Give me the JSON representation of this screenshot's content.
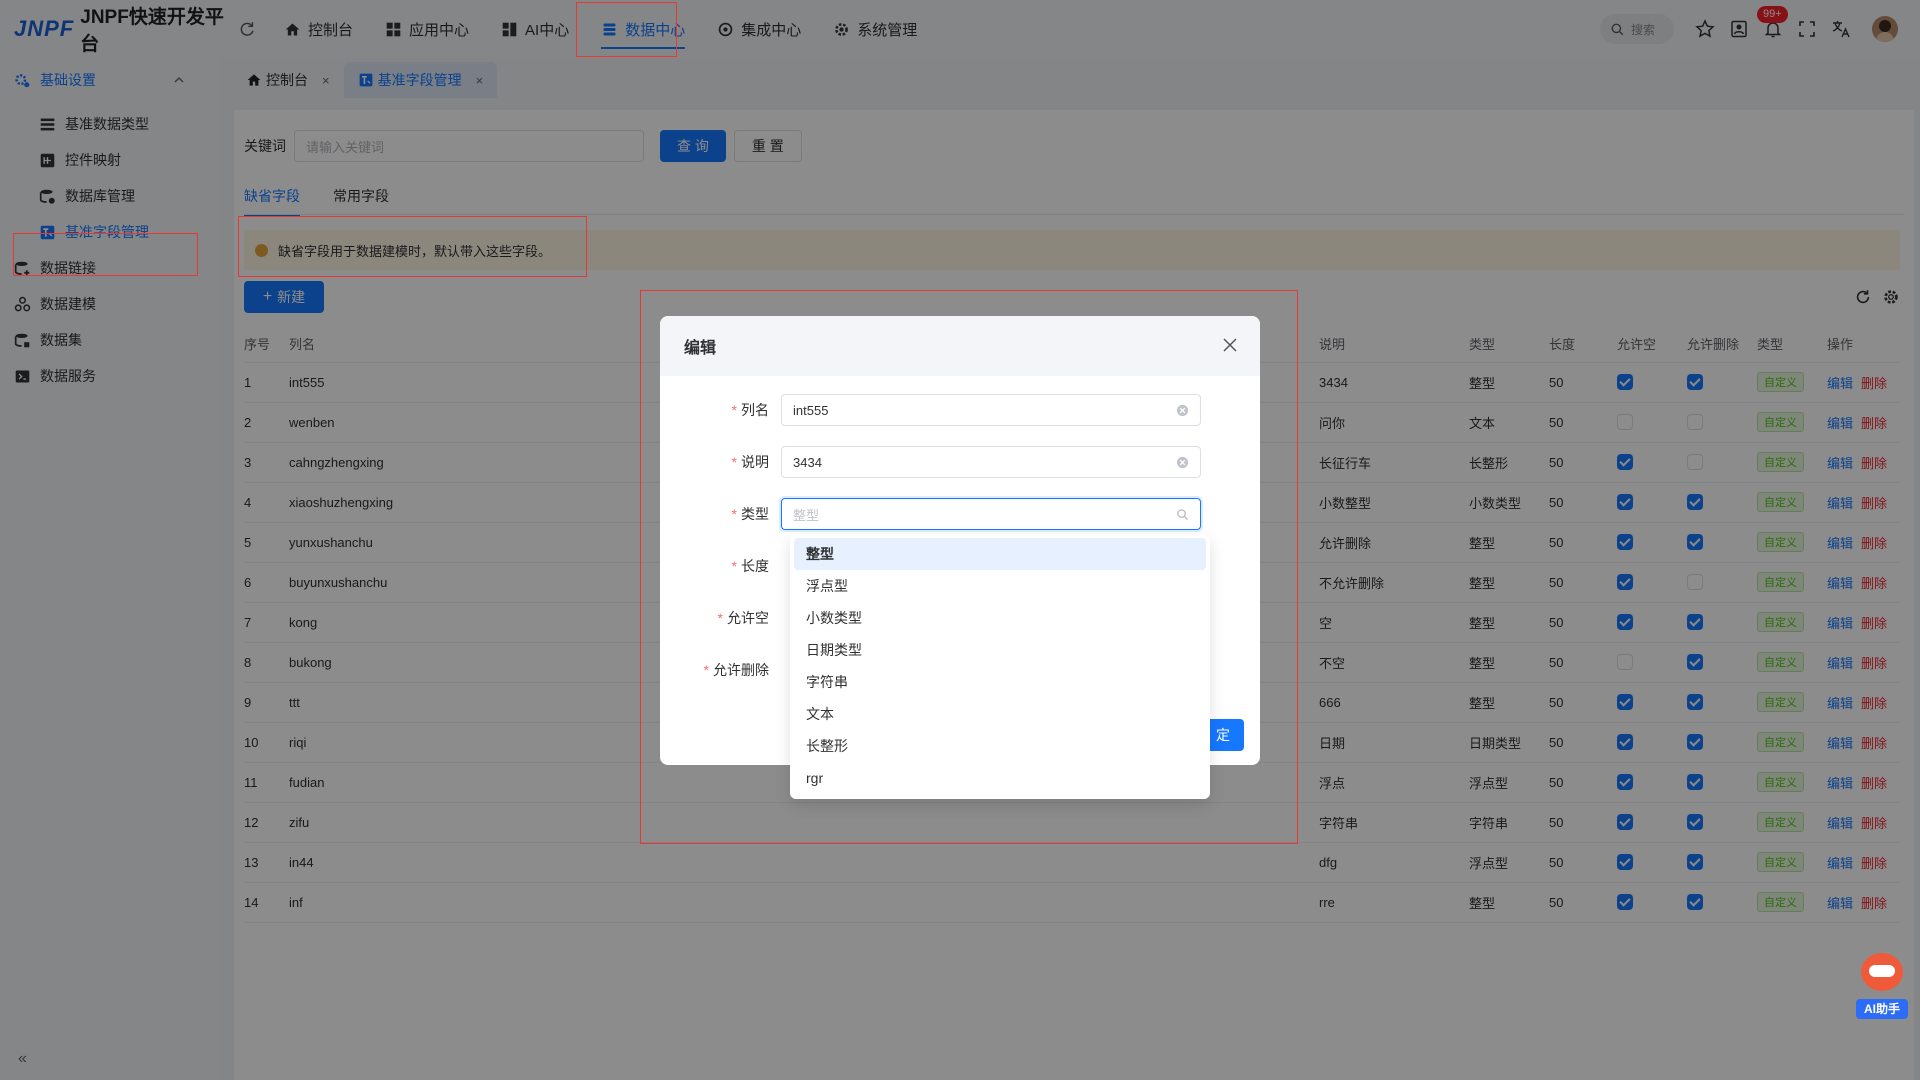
{
  "app": {
    "logo_mark": "JNPF",
    "title": "JNPF快速开发平台"
  },
  "topnav": [
    {
      "label": "控制台",
      "icon": "home-icon"
    },
    {
      "label": "应用中心",
      "icon": "apps-icon"
    },
    {
      "label": "AI中心",
      "icon": "ai-icon"
    },
    {
      "label": "数据中心",
      "icon": "database-icon"
    },
    {
      "label": "集成中心",
      "icon": "integration-icon"
    },
    {
      "label": "系统管理",
      "icon": "gear-icon"
    }
  ],
  "header_right": {
    "search_placeholder": "搜索",
    "notification_badge": "99+"
  },
  "sidebar": {
    "items": [
      {
        "label": "基础设置",
        "icon": "settings-group-icon"
      },
      {
        "label": "基准数据类型",
        "icon": "list-icon"
      },
      {
        "label": "控件映射",
        "icon": "map-icon"
      },
      {
        "label": "数据库管理",
        "icon": "db-icon"
      },
      {
        "label": "基准字段管理",
        "icon": "field-icon"
      },
      {
        "label": "数据链接",
        "icon": "link-icon"
      },
      {
        "label": "数据建模",
        "icon": "model-icon"
      },
      {
        "label": "数据集",
        "icon": "dataset-icon"
      },
      {
        "label": "数据服务",
        "icon": "service-icon"
      }
    ],
    "collapse": "«"
  },
  "page_tabs": [
    {
      "label": "控制台",
      "close": "×"
    },
    {
      "label": "基准字段管理",
      "close": "×"
    }
  ],
  "search": {
    "label": "关键词",
    "placeholder": "请输入关键词",
    "query_btn": "查 询",
    "reset_btn": "重 置"
  },
  "subtabs": [
    "缺省字段",
    "常用字段"
  ],
  "alert": "缺省字段用于数据建模时，默认带入这些字段。",
  "new_btn": "新建",
  "table": {
    "headers": [
      "序号",
      "列名",
      "说明",
      "类型",
      "长度",
      "允许空",
      "允许删除",
      "类型",
      "操作"
    ],
    "rows": [
      {
        "no": "1",
        "name": "int555",
        "desc": "3434",
        "type": "整型",
        "len": "50",
        "nullable": true,
        "deletable": true,
        "kind": "自定义"
      },
      {
        "no": "2",
        "name": "wenben",
        "desc": "问你",
        "type": "文本",
        "len": "50",
        "nullable": false,
        "deletable": false,
        "kind": "自定义"
      },
      {
        "no": "3",
        "name": "cahngzhengxing",
        "desc": "长征行车",
        "type": "长整形",
        "len": "50",
        "nullable": true,
        "deletable": false,
        "kind": "自定义"
      },
      {
        "no": "4",
        "name": "xiaoshuzhengxing",
        "desc": "小数整型",
        "type": "小数类型",
        "len": "50",
        "nullable": true,
        "deletable": true,
        "kind": "自定义"
      },
      {
        "no": "5",
        "name": "yunxushanchu",
        "desc": "允许删除",
        "type": "整型",
        "len": "50",
        "nullable": true,
        "deletable": true,
        "kind": "自定义"
      },
      {
        "no": "6",
        "name": "buyunxushanchu",
        "desc": "不允许删除",
        "type": "整型",
        "len": "50",
        "nullable": true,
        "deletable": false,
        "kind": "自定义"
      },
      {
        "no": "7",
        "name": "kong",
        "desc": "空",
        "type": "整型",
        "len": "50",
        "nullable": true,
        "deletable": true,
        "kind": "自定义"
      },
      {
        "no": "8",
        "name": "bukong",
        "desc": "不空",
        "type": "整型",
        "len": "50",
        "nullable": false,
        "deletable": true,
        "kind": "自定义"
      },
      {
        "no": "9",
        "name": "ttt",
        "desc": "666",
        "type": "整型",
        "len": "50",
        "nullable": true,
        "deletable": true,
        "kind": "自定义"
      },
      {
        "no": "10",
        "name": "riqi",
        "desc": "日期",
        "type": "日期类型",
        "len": "50",
        "nullable": true,
        "deletable": true,
        "kind": "自定义"
      },
      {
        "no": "11",
        "name": "fudian",
        "desc": "浮点",
        "type": "浮点型",
        "len": "50",
        "nullable": true,
        "deletable": true,
        "kind": "自定义"
      },
      {
        "no": "12",
        "name": "zifu",
        "desc": "字符串",
        "type": "字符串",
        "len": "50",
        "nullable": true,
        "deletable": true,
        "kind": "自定义"
      },
      {
        "no": "13",
        "name": "in44",
        "desc": "dfg",
        "type": "浮点型",
        "len": "50",
        "nullable": true,
        "deletable": true,
        "kind": "自定义"
      },
      {
        "no": "14",
        "name": "inf",
        "desc": "rre",
        "type": "整型",
        "len": "50",
        "nullable": true,
        "deletable": true,
        "kind": "自定义"
      }
    ],
    "edit_label": "编辑",
    "delete_label": "删除"
  },
  "dialog": {
    "title": "编辑",
    "fields": {
      "name_label": "列名",
      "name_value": "int555",
      "desc_label": "说明",
      "desc_value": "3434",
      "type_label": "类型",
      "type_placeholder": "整型",
      "len_label": "长度",
      "nullable_label": "允许空",
      "deletable_label": "允许删除"
    },
    "ok_btn": "定"
  },
  "type_options": [
    "整型",
    "浮点型",
    "小数类型",
    "日期类型",
    "字符串",
    "文本",
    "长整形",
    "rgr"
  ],
  "ai_helper": {
    "label": "AI助手"
  },
  "colors": {
    "accent": "#1677ff",
    "danger": "#f5222d",
    "highlight_box": "#e53935"
  }
}
